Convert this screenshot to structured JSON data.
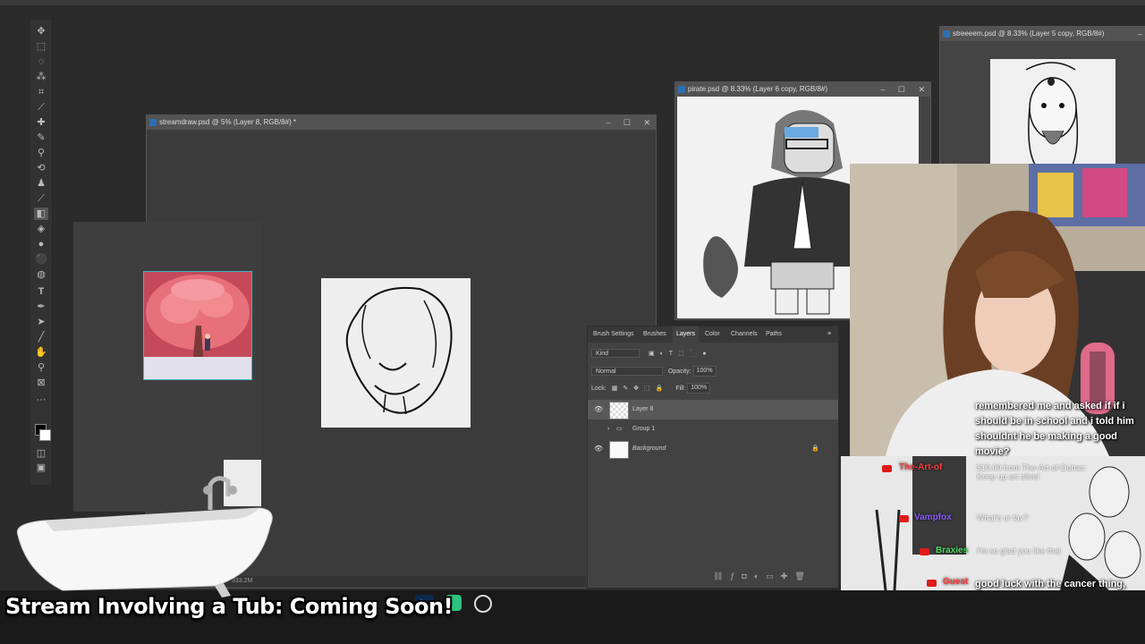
{
  "colors": {
    "workspace": "#2b2b2b",
    "panel": "#424242",
    "accent": "#2c6fb3",
    "youtube_red": "#e01b1b"
  },
  "windows": {
    "streamdraw": {
      "title": "streamdraw.psd @ 5% (Layer 8, RGB/8#) *"
    },
    "pirate": {
      "title": "pirate.psd @ 8.33% (Layer 6 copy, RGB/8#)"
    },
    "streeeem": {
      "title": "streeeem.psd @ 8.33% (Layer 5 copy, RGB/8#)"
    }
  },
  "window_controls": {
    "minimize": "–",
    "maximize": "☐",
    "close": "✕"
  },
  "status_bar": {
    "doc_size": "333.2M"
  },
  "panel": {
    "tabs": [
      "Brush Settings",
      "Brushes",
      "Layers",
      "Color",
      "Channels",
      "Paths"
    ],
    "active_tab": "Layers",
    "filter_kind": "Kind",
    "blend_mode": "Normal",
    "opacity_label": "Opacity:",
    "opacity_value": "100%",
    "lock_label": "Lock:",
    "fill_label": "Fill:",
    "fill_value": "100%",
    "layers": [
      {
        "name": "Layer 8",
        "selected": true,
        "visible": true
      },
      {
        "name": "Group 1",
        "selected": false,
        "visible": false
      },
      {
        "name": "Background",
        "selected": false,
        "visible": true,
        "locked": true
      }
    ]
  },
  "chat": {
    "message": "remembered me and asked if if i should be in school and i told him shouldnt he be making a good movie?",
    "message2": "good luck with the cancer thing, my Mam got through it, but it was one of the easier types",
    "users": [
      {
        "name": "The-Art-of",
        "color": "#ff3b3b",
        "text": "$10.00 from The-Art-of-Dubac: Keep up art alive!"
      },
      {
        "name": "Vampfox",
        "color": "#8a5cff",
        "text": "What's ur fav?"
      },
      {
        "name": "Braxies",
        "color": "#4cd964",
        "text": "I'm so glad you like that"
      },
      {
        "name": "Guest",
        "color": "#ff3b3b",
        "text": ""
      }
    ]
  },
  "banner": {
    "text": "Stream Involving a Tub: Coming Soon!"
  },
  "taskbar": {
    "icons": [
      "photoshop-icon",
      "discord-icon",
      "obs-icon"
    ]
  }
}
